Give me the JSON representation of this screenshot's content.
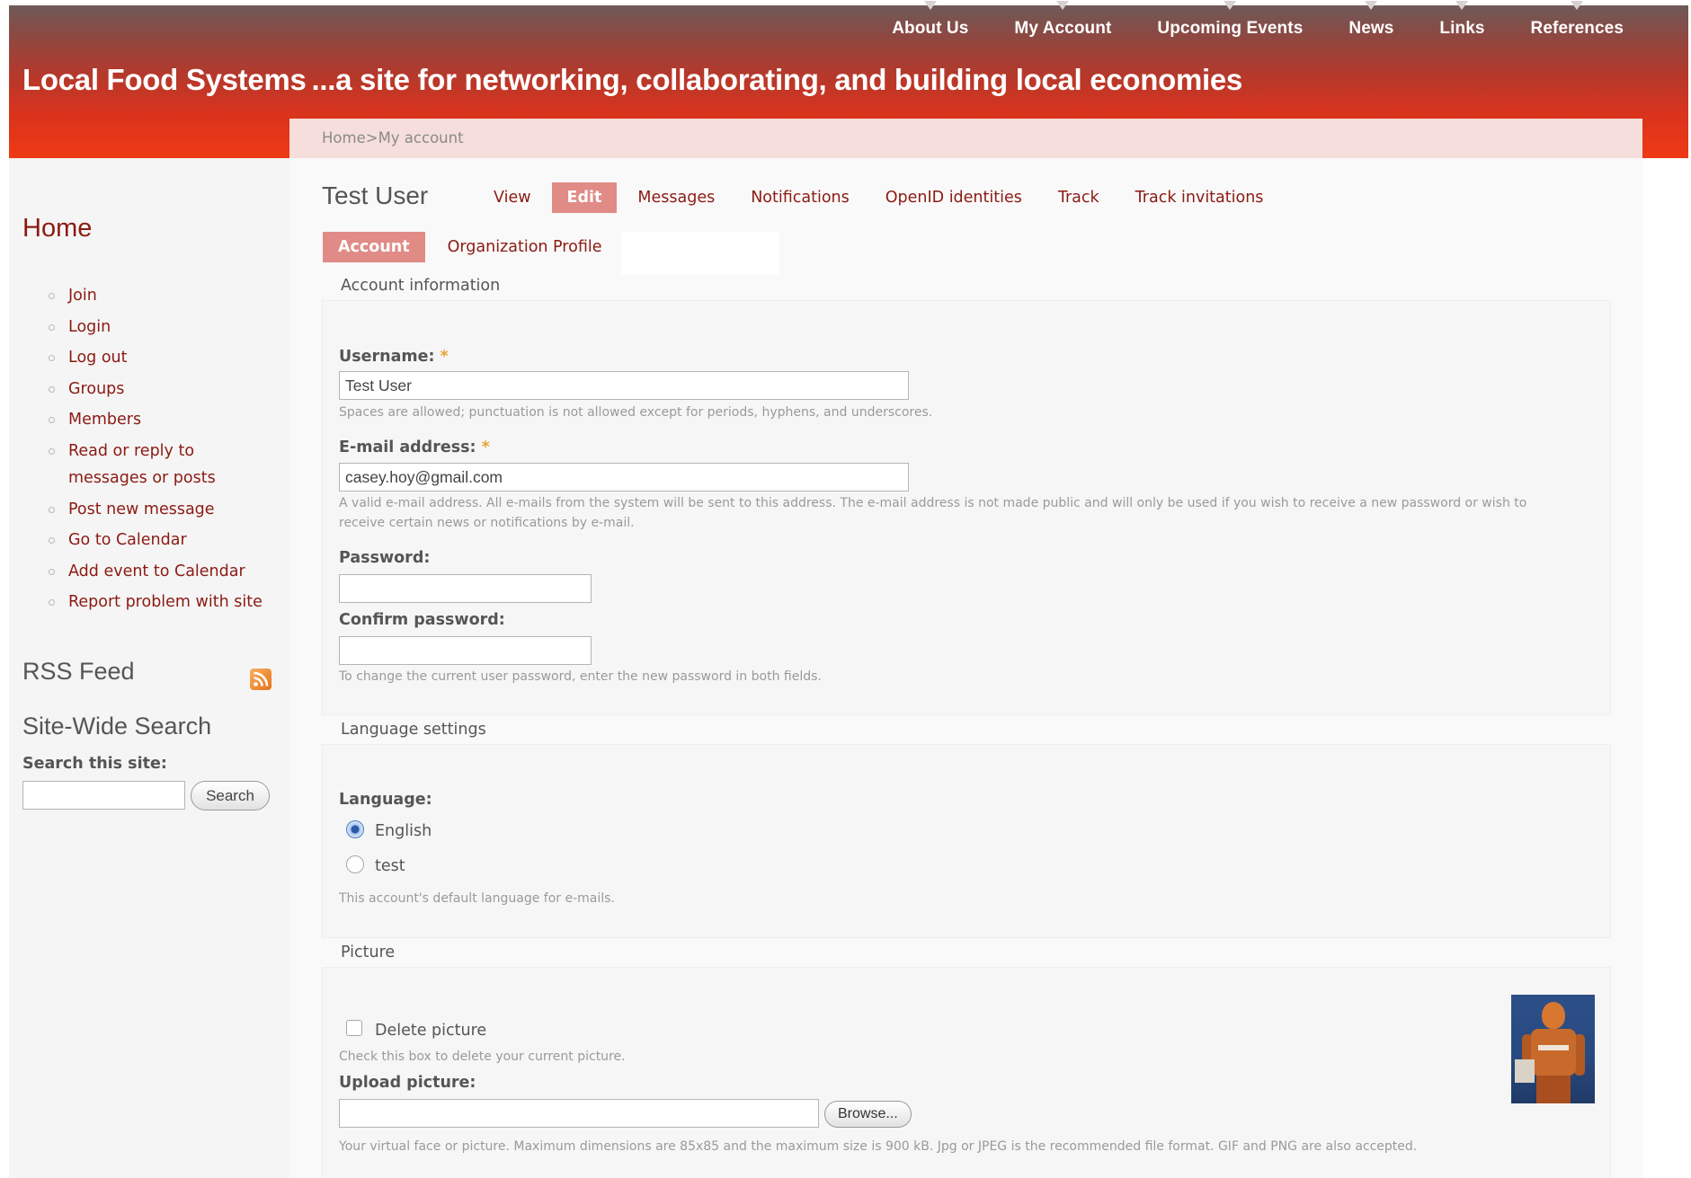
{
  "header": {
    "nav": [
      "About Us",
      "My Account",
      "Upcoming Events",
      "News",
      "Links",
      "References"
    ],
    "site_name": "Local Food Systems",
    "slogan": "...a site for networking, collaborating, and building local economies"
  },
  "breadcrumb": {
    "home": "Home",
    "separator": ">",
    "current": "My account"
  },
  "sidebar": {
    "home_title": "Home",
    "menu": [
      "Join",
      "Login",
      "Log out",
      "Groups",
      "Members",
      "Read or reply to messages or posts",
      "Post new message",
      "Go to Calendar",
      "Add event to Calendar",
      "Report problem with site"
    ],
    "rss_title": "RSS Feed",
    "search_title": "Site-Wide Search",
    "search_label": "Search this site:",
    "search_value": "",
    "search_button": "Search"
  },
  "main": {
    "user_name": "Test User",
    "primary_tabs": [
      "View",
      "Edit",
      "Messages",
      "Notifications",
      "OpenID identities",
      "Track",
      "Track invitations"
    ],
    "secondary_tabs": [
      "Account",
      "Organization Profile"
    ],
    "account": {
      "legend": "Account information",
      "username_label": "Username:",
      "username_value": "Test User",
      "username_desc": "Spaces are allowed; punctuation is not allowed except for periods, hyphens, and underscores.",
      "email_label": "E-mail address:",
      "email_value": "casey.hoy@gmail.com",
      "email_desc_1": "A valid e-mail address. All e-mails from the system will be sent to this address. The e-mail address is not made public and will only be used if you wish to receive a new password or wish to",
      "email_desc_2": "receive certain news or notifications by e-mail.",
      "password_label": "Password:",
      "password_value": "",
      "confirm_label": "Confirm password:",
      "confirm_value": "",
      "password_desc": "To change the current user password, enter the new password in both fields."
    },
    "language": {
      "legend": "Language settings",
      "label": "Language:",
      "options": [
        "English",
        "test"
      ],
      "selected": "English",
      "desc": "This account's default language for e-mails."
    },
    "picture": {
      "legend": "Picture",
      "delete_label": "Delete picture",
      "delete_desc": "Check this box to delete your current picture.",
      "upload_label": "Upload picture:",
      "upload_value": "",
      "browse_button": "Browse...",
      "upload_desc": "Your virtual face or picture. Maximum dimensions are 85x85 and the maximum size is 900 kB. Jpg or JPEG is the recommended file format. GIF and PNG are also accepted."
    }
  },
  "colors": {
    "header_top": "#6e5a58",
    "header_bottom": "#ef3a14",
    "link": "#8b1a13",
    "active_tab": "#e08b86",
    "required": "#e8a536"
  }
}
